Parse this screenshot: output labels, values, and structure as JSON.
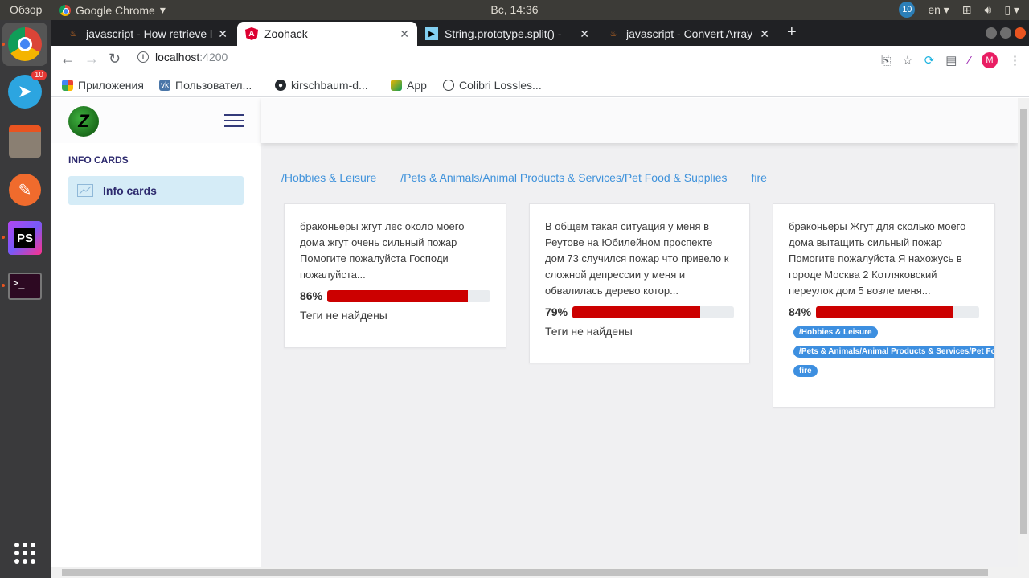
{
  "topbar": {
    "overview": "Обзор",
    "app_name": "Google Chrome",
    "clock": "Вс, 14:36",
    "notif_count": "10",
    "lang": "en"
  },
  "launcher": {
    "telegram_badge": "10",
    "phpstorm_label": "PS"
  },
  "tabs": [
    {
      "title": "javascript - How retrieve l",
      "active": false
    },
    {
      "title": "Zoohack",
      "active": true
    },
    {
      "title": "String.prototype.split() -",
      "active": false
    },
    {
      "title": "javascript - Convert Array",
      "active": false
    }
  ],
  "address": {
    "host": "localhost",
    "port": ":4200"
  },
  "profile_initial": "M",
  "bookmarks": [
    {
      "label": "Приложения"
    },
    {
      "label": "Пользовател..."
    },
    {
      "label": "kirschbaum-d..."
    },
    {
      "label": "App"
    },
    {
      "label": "Colibri Lossles..."
    }
  ],
  "sidebar": {
    "logo": "Z",
    "section_title": "INFO CARDS",
    "item_label": "Info cards"
  },
  "filters": [
    "/Hobbies & Leisure",
    "/Pets & Animals/Animal Products & Services/Pet Food & Supplies",
    "fire"
  ],
  "cards": [
    {
      "text": "браконьеры жгут лес около моего дома жгут очень сильный пожар Помогите пожалуйста Господи пожалуйста...",
      "percent": "86%",
      "percent_value": 86,
      "no_tags": "Теги не найдены",
      "tags": []
    },
    {
      "text": "В общем такая ситуация у меня в Реутове на Юбилейном проспекте дом 73 случился пожар что привело к сложной депрессии у меня и обвалилась дерево котор...",
      "percent": "79%",
      "percent_value": 79,
      "no_tags": "Теги не найдены",
      "tags": []
    },
    {
      "text": "браконьеры Жгут для сколько моего дома вытащить сильный пожар Помогите пожалуйста Я нахожусь в городе Москва 2 Котляковский переулок дом 5 возле меня...",
      "percent": "84%",
      "percent_value": 84,
      "no_tags": "",
      "tags": [
        "/Hobbies & Leisure",
        "/Pets & Animals/Animal Products & Services/Pet Food & Supplies",
        "fire"
      ]
    }
  ],
  "colors": {
    "accent": "#3f92db",
    "bar_fill": "#cc0000",
    "active_item": "#d5ecf7",
    "nav_text": "#2d2a6e"
  }
}
